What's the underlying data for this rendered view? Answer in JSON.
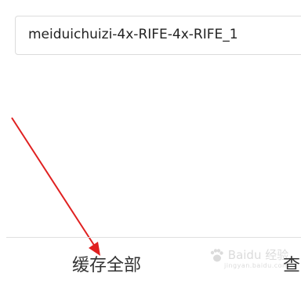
{
  "filename_field": {
    "value": "meiduichuizi-4x-RIFE-4x-RIFE_1"
  },
  "bottom_bar": {
    "cache_all_label": "缓存全部",
    "view_label": "查"
  },
  "watermark": {
    "text": "Baidu 经验",
    "subtext": "jingyan.baidu.com"
  },
  "annotation_arrow": {
    "color": "#e02020",
    "icon": "arrow-icon"
  }
}
